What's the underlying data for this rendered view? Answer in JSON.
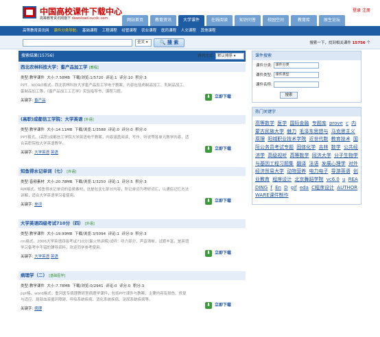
{
  "header": {
    "title": "中国高校课件下载中心",
    "subtitle": "高等教育资讯网旗下",
    "domain": "download.cucdc.com",
    "login": "登录",
    "register": "注册"
  },
  "nav": {
    "tabs": [
      "网站首页",
      "教育资讯",
      "大学课件",
      "在线阅读",
      "知识问答",
      "校园空间",
      "教育库",
      "原生论坛"
    ],
    "active": "大学课件"
  },
  "subnav": {
    "items": [
      "高等教育资讯网",
      "课件分类导航:",
      "基础课程",
      "工程课程",
      "经管课程",
      "农业课程",
      "医药课程",
      "人文课程",
      "其他课程"
    ]
  },
  "search": {
    "input_value": "",
    "scope": "全文",
    "button": "搜 索",
    "stat_prefix": "搜索一下，找到相关课件",
    "stat_count": "15756",
    "stat_suffix": "个"
  },
  "results": {
    "header": "搜索结果(15756)",
    "sort_label": "排列方式:",
    "sort_value": "默认排序",
    "download_label": "立即下载",
    "labels": {
      "type": "类型:",
      "size": "大小:",
      "views": "下载/浏览:",
      "comments": "评论:",
      "score": "评分:",
      "points": "积分:",
      "keywords": "关键字:"
    },
    "items": [
      {
        "title": "西北农林科技大学：畜产品加工学",
        "tag": "[教程]",
        "type": "教学课件",
        "size": "7.58MB",
        "views": "1/5720",
        "comments": "1",
        "score": "10",
        "points": "3",
        "desc": "PPT、WORD格式。西北农林科技大学畜产品加工学电子教案，内容包括肉制品加工、乳制品加工、蛋制品加工等，《畜产品加工工艺学》实验指导书，课程习题。",
        "keywords": [
          "畜产品"
        ]
      },
      {
        "title": "(高职)成都信工学院：大学英语",
        "tag": "[外语]",
        "type": "教学课件",
        "size": "14.11MB",
        "views": "1/3588",
        "comments": "0",
        "score": "0",
        "points": "0",
        "desc": "PPT格式。(高职)成都信工学院大学英语电子教案，内容涵盖阅读、写作、听说等各单元教学内容，适合高职院校大学英语教学。",
        "keywords": [
          "大学英语",
          "英语"
        ]
      },
      {
        "title": "知鱼得水记单词（七）",
        "tag": "[外语]",
        "type": "音频素材",
        "size": "20.78MB",
        "views": "1/3250",
        "comments": "1",
        "score": "5",
        "points": "3",
        "desc": "RM格式。知鱼得水记单词的音频素材，这是包含七部分内容，所记单词为考研词汇，以通俗记忆方法讲解，适合大学英语学习者使用。",
        "keywords": [
          "单词"
        ]
      },
      {
        "title": "大学英语四级考试710分（四）",
        "tag": "[外语]",
        "type": "教学课件",
        "size": "19.99MB",
        "views": "3/5094",
        "comments": "1",
        "score": "9",
        "points": "3",
        "desc": "rm格式。2006大学英语四级考试710分(最火热讲解)试听：听力部分，声音清晰，试题丰富，是英语学习备考中不错的辅导资料，欢迎同学参考使用。",
        "keywords": [
          "大学英语",
          "英语"
        ]
      },
      {
        "title": "病理学（二）",
        "tag": "[基础医学]",
        "type": "教学课件",
        "size": "7.78MB",
        "views": "0/2941",
        "comments": "0",
        "score": "0",
        "points": "3",
        "desc": "ppt格，word格式，重河医专病理教研室病理学课件，包括PPT课件与教案，主要内容有损伤、修复与适应、局部血液循环障碍、呼吸系统疾病、消化系统疾病、泌尿系统疾病等。",
        "keywords": [
          "病理"
        ]
      }
    ]
  },
  "sidebar": {
    "search_title": "课件搜索",
    "category_label": "课件分类:",
    "category_value": "课件分类",
    "type_label": "课件类型:",
    "type_value": "课件类型",
    "name_label": "课件名称:",
    "search_button": "搜索",
    "hot_title": "热门关键字",
    "hot_keywords": [
      "高等数学",
      "医学",
      "国际金融",
      "专题库",
      "prove",
      "c",
      "内蒙古民族大学",
      "魅力",
      "毛泽东思想与",
      "马克思主义原理",
      "阳城职业技术学院",
      "近世代数",
      "教育技术",
      "国际公务员考试专题",
      "固体化学",
      "吉林",
      "数学",
      "公共经济学",
      "高级视听",
      "高等数学",
      "同济大学",
      "分子生物学与基因工程习题集",
      "翻译",
      "法语",
      "发展心理学",
      "对外经济贸易大学",
      "动物营养",
      "电力电子",
      "导游英语",
      "创业教育",
      "程序设计",
      "北京舞蹈学院",
      "vc6.0",
      "u",
      "READING",
      "f",
      "En",
      "D",
      "gif",
      "eda",
      "C程序设计",
      "AUTHORWARE课件制作"
    ]
  }
}
